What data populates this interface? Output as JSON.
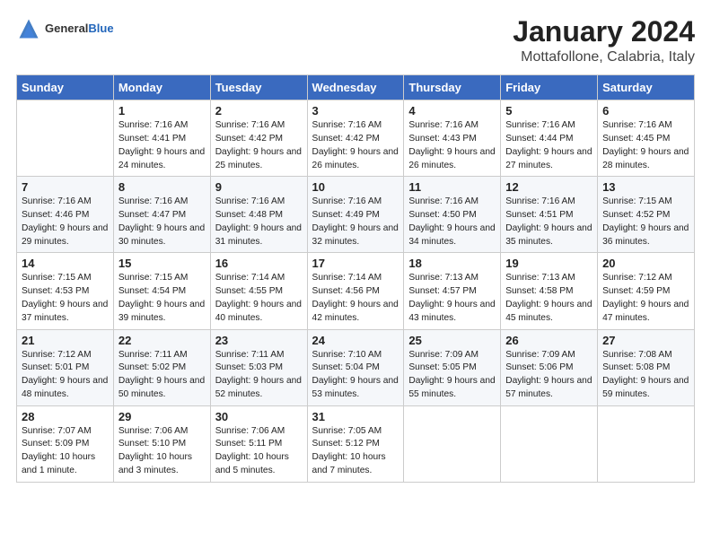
{
  "header": {
    "logo_general": "General",
    "logo_blue": "Blue",
    "title": "January 2024",
    "subtitle": "Mottafollone, Calabria, Italy"
  },
  "days_of_week": [
    "Sunday",
    "Monday",
    "Tuesday",
    "Wednesday",
    "Thursday",
    "Friday",
    "Saturday"
  ],
  "weeks": [
    [
      {
        "day": "",
        "sunrise": "",
        "sunset": "",
        "daylight": ""
      },
      {
        "day": "1",
        "sunrise": "Sunrise: 7:16 AM",
        "sunset": "Sunset: 4:41 PM",
        "daylight": "Daylight: 9 hours and 24 minutes."
      },
      {
        "day": "2",
        "sunrise": "Sunrise: 7:16 AM",
        "sunset": "Sunset: 4:42 PM",
        "daylight": "Daylight: 9 hours and 25 minutes."
      },
      {
        "day": "3",
        "sunrise": "Sunrise: 7:16 AM",
        "sunset": "Sunset: 4:42 PM",
        "daylight": "Daylight: 9 hours and 26 minutes."
      },
      {
        "day": "4",
        "sunrise": "Sunrise: 7:16 AM",
        "sunset": "Sunset: 4:43 PM",
        "daylight": "Daylight: 9 hours and 26 minutes."
      },
      {
        "day": "5",
        "sunrise": "Sunrise: 7:16 AM",
        "sunset": "Sunset: 4:44 PM",
        "daylight": "Daylight: 9 hours and 27 minutes."
      },
      {
        "day": "6",
        "sunrise": "Sunrise: 7:16 AM",
        "sunset": "Sunset: 4:45 PM",
        "daylight": "Daylight: 9 hours and 28 minutes."
      }
    ],
    [
      {
        "day": "7",
        "sunrise": "Sunrise: 7:16 AM",
        "sunset": "Sunset: 4:46 PM",
        "daylight": "Daylight: 9 hours and 29 minutes."
      },
      {
        "day": "8",
        "sunrise": "Sunrise: 7:16 AM",
        "sunset": "Sunset: 4:47 PM",
        "daylight": "Daylight: 9 hours and 30 minutes."
      },
      {
        "day": "9",
        "sunrise": "Sunrise: 7:16 AM",
        "sunset": "Sunset: 4:48 PM",
        "daylight": "Daylight: 9 hours and 31 minutes."
      },
      {
        "day": "10",
        "sunrise": "Sunrise: 7:16 AM",
        "sunset": "Sunset: 4:49 PM",
        "daylight": "Daylight: 9 hours and 32 minutes."
      },
      {
        "day": "11",
        "sunrise": "Sunrise: 7:16 AM",
        "sunset": "Sunset: 4:50 PM",
        "daylight": "Daylight: 9 hours and 34 minutes."
      },
      {
        "day": "12",
        "sunrise": "Sunrise: 7:16 AM",
        "sunset": "Sunset: 4:51 PM",
        "daylight": "Daylight: 9 hours and 35 minutes."
      },
      {
        "day": "13",
        "sunrise": "Sunrise: 7:15 AM",
        "sunset": "Sunset: 4:52 PM",
        "daylight": "Daylight: 9 hours and 36 minutes."
      }
    ],
    [
      {
        "day": "14",
        "sunrise": "Sunrise: 7:15 AM",
        "sunset": "Sunset: 4:53 PM",
        "daylight": "Daylight: 9 hours and 37 minutes."
      },
      {
        "day": "15",
        "sunrise": "Sunrise: 7:15 AM",
        "sunset": "Sunset: 4:54 PM",
        "daylight": "Daylight: 9 hours and 39 minutes."
      },
      {
        "day": "16",
        "sunrise": "Sunrise: 7:14 AM",
        "sunset": "Sunset: 4:55 PM",
        "daylight": "Daylight: 9 hours and 40 minutes."
      },
      {
        "day": "17",
        "sunrise": "Sunrise: 7:14 AM",
        "sunset": "Sunset: 4:56 PM",
        "daylight": "Daylight: 9 hours and 42 minutes."
      },
      {
        "day": "18",
        "sunrise": "Sunrise: 7:13 AM",
        "sunset": "Sunset: 4:57 PM",
        "daylight": "Daylight: 9 hours and 43 minutes."
      },
      {
        "day": "19",
        "sunrise": "Sunrise: 7:13 AM",
        "sunset": "Sunset: 4:58 PM",
        "daylight": "Daylight: 9 hours and 45 minutes."
      },
      {
        "day": "20",
        "sunrise": "Sunrise: 7:12 AM",
        "sunset": "Sunset: 4:59 PM",
        "daylight": "Daylight: 9 hours and 47 minutes."
      }
    ],
    [
      {
        "day": "21",
        "sunrise": "Sunrise: 7:12 AM",
        "sunset": "Sunset: 5:01 PM",
        "daylight": "Daylight: 9 hours and 48 minutes."
      },
      {
        "day": "22",
        "sunrise": "Sunrise: 7:11 AM",
        "sunset": "Sunset: 5:02 PM",
        "daylight": "Daylight: 9 hours and 50 minutes."
      },
      {
        "day": "23",
        "sunrise": "Sunrise: 7:11 AM",
        "sunset": "Sunset: 5:03 PM",
        "daylight": "Daylight: 9 hours and 52 minutes."
      },
      {
        "day": "24",
        "sunrise": "Sunrise: 7:10 AM",
        "sunset": "Sunset: 5:04 PM",
        "daylight": "Daylight: 9 hours and 53 minutes."
      },
      {
        "day": "25",
        "sunrise": "Sunrise: 7:09 AM",
        "sunset": "Sunset: 5:05 PM",
        "daylight": "Daylight: 9 hours and 55 minutes."
      },
      {
        "day": "26",
        "sunrise": "Sunrise: 7:09 AM",
        "sunset": "Sunset: 5:06 PM",
        "daylight": "Daylight: 9 hours and 57 minutes."
      },
      {
        "day": "27",
        "sunrise": "Sunrise: 7:08 AM",
        "sunset": "Sunset: 5:08 PM",
        "daylight": "Daylight: 9 hours and 59 minutes."
      }
    ],
    [
      {
        "day": "28",
        "sunrise": "Sunrise: 7:07 AM",
        "sunset": "Sunset: 5:09 PM",
        "daylight": "Daylight: 10 hours and 1 minute."
      },
      {
        "day": "29",
        "sunrise": "Sunrise: 7:06 AM",
        "sunset": "Sunset: 5:10 PM",
        "daylight": "Daylight: 10 hours and 3 minutes."
      },
      {
        "day": "30",
        "sunrise": "Sunrise: 7:06 AM",
        "sunset": "Sunset: 5:11 PM",
        "daylight": "Daylight: 10 hours and 5 minutes."
      },
      {
        "day": "31",
        "sunrise": "Sunrise: 7:05 AM",
        "sunset": "Sunset: 5:12 PM",
        "daylight": "Daylight: 10 hours and 7 minutes."
      },
      {
        "day": "",
        "sunrise": "",
        "sunset": "",
        "daylight": ""
      },
      {
        "day": "",
        "sunrise": "",
        "sunset": "",
        "daylight": ""
      },
      {
        "day": "",
        "sunrise": "",
        "sunset": "",
        "daylight": ""
      }
    ]
  ]
}
